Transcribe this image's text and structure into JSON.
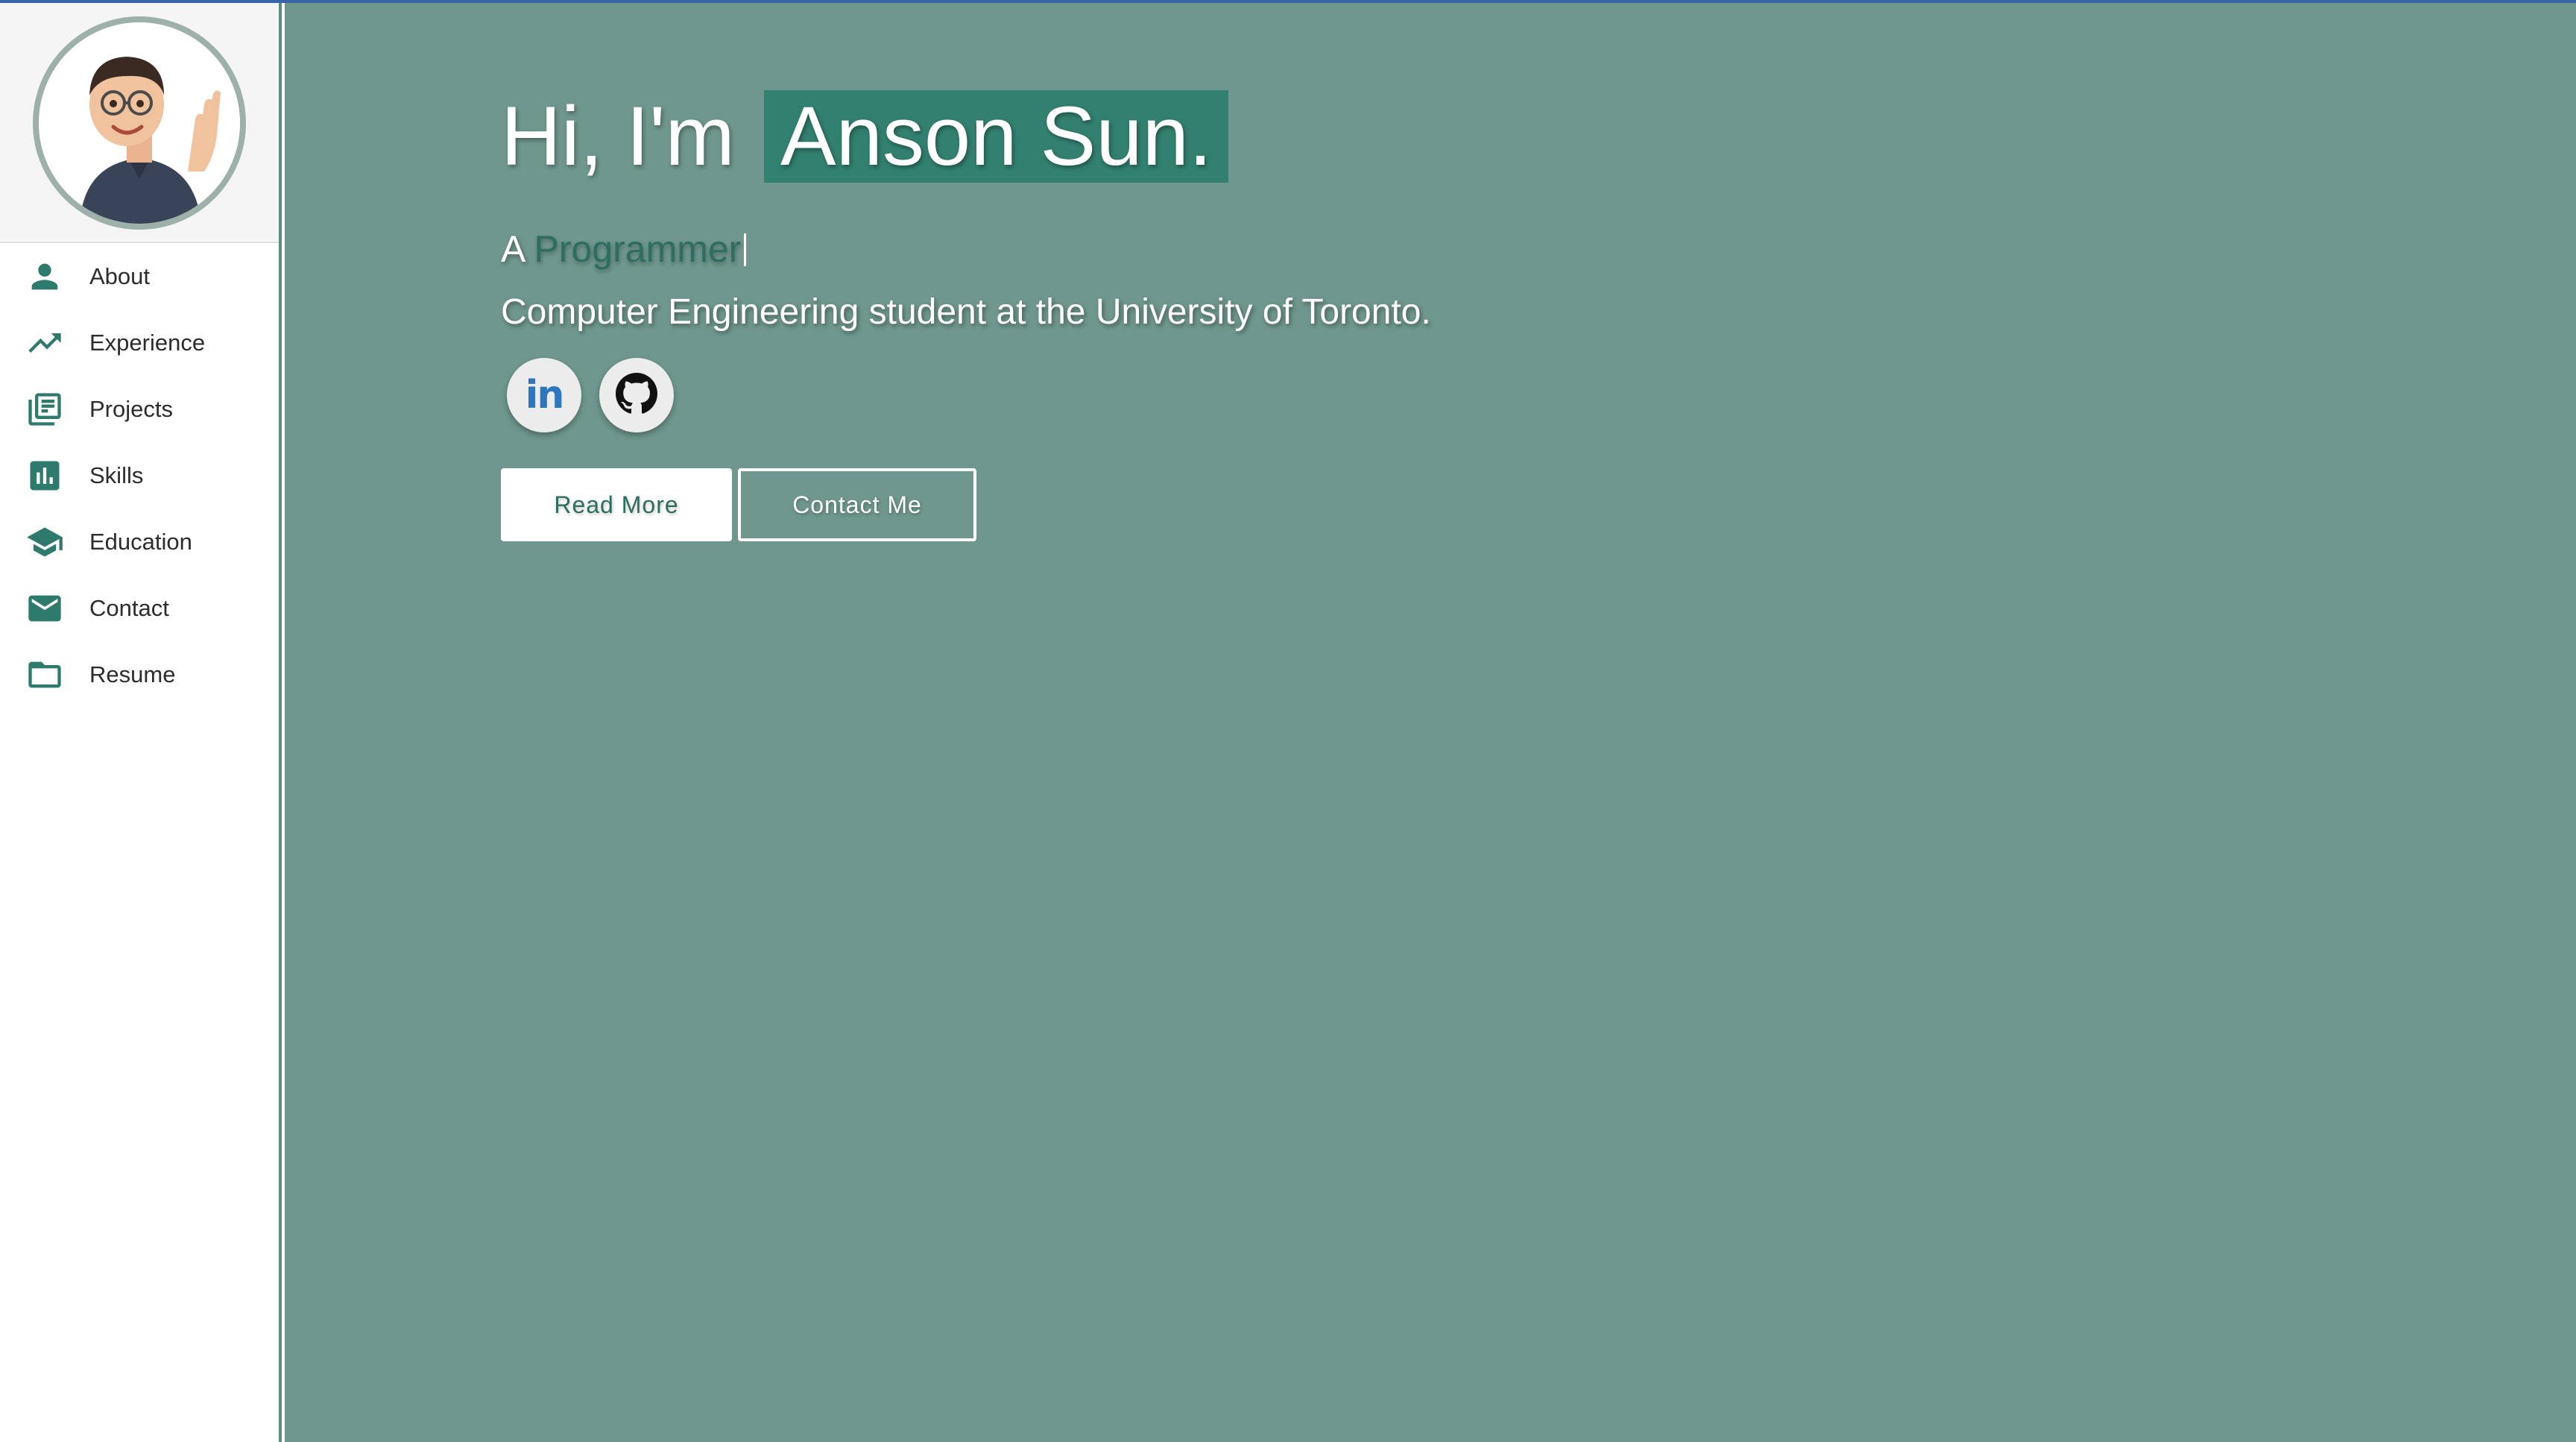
{
  "sidebar": {
    "avatar_alt": "Memoji avatar waving",
    "items": [
      {
        "label": "About",
        "icon": "person-icon"
      },
      {
        "label": "Experience",
        "icon": "trending-up-icon"
      },
      {
        "label": "Projects",
        "icon": "library-books-icon"
      },
      {
        "label": "Skills",
        "icon": "bar-chart-icon"
      },
      {
        "label": "Education",
        "icon": "school-icon"
      },
      {
        "label": "Contact",
        "icon": "mail-icon"
      },
      {
        "label": "Resume",
        "icon": "folder-icon"
      }
    ]
  },
  "hero": {
    "greeting": "Hi, I'm",
    "name": "Anson Sun.",
    "role_prefix": "A",
    "role": "Programmer",
    "tagline": "Computer Engineering student at the University of Toronto."
  },
  "socials": {
    "linkedin_label": "in",
    "linkedin_icon": "linkedin-icon",
    "github_icon": "github-icon"
  },
  "buttons": {
    "read_more": "Read More",
    "contact_me": "Contact Me"
  },
  "colors": {
    "accent": "#2e7a6c",
    "background": "#6f978d",
    "name_highlight": "#32806f",
    "top_line": "#3a64a8"
  }
}
